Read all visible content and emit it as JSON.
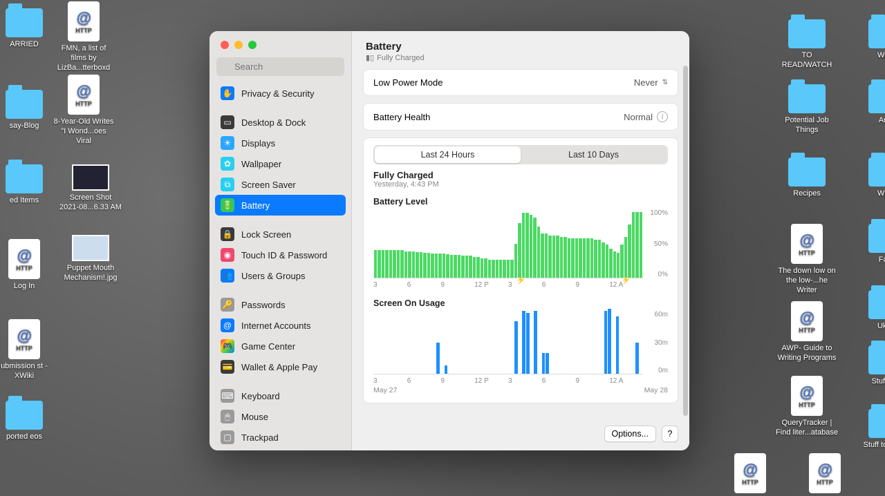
{
  "desktop_icons": {
    "left": [
      {
        "type": "fold",
        "label": "ARRIED"
      },
      {
        "type": "file",
        "label": "FMN, a list of films by LizBa...tterboxd"
      },
      {
        "type": "fold",
        "label": "say-Blog"
      },
      {
        "type": "file",
        "label": "8-Year-Old Writes \"I Wond...oes Viral"
      },
      {
        "type": "fold",
        "label": "ed Items"
      },
      {
        "type": "thumb",
        "label": "Screen Shot 2021-08...6.33 AM"
      },
      {
        "type": "file",
        "label": "Log In"
      },
      {
        "type": "thumb",
        "label": "Puppet Mouth Mechanism!.jpg"
      },
      {
        "type": "file",
        "label": "ubmission st - XWiki"
      },
      {
        "type": "fold",
        "label": "ported eos"
      }
    ],
    "right": [
      {
        "type": "fold",
        "label": "TO READ/WATCH"
      },
      {
        "type": "fold",
        "label": "Webc"
      },
      {
        "type": "fold",
        "label": "Potential Job Things"
      },
      {
        "type": "fold",
        "label": "Art S"
      },
      {
        "type": "fold",
        "label": "Recipes"
      },
      {
        "type": "fold",
        "label": "Writin"
      },
      {
        "type": "file",
        "label": "The down low on the low-...he Writer"
      },
      {
        "type": "fold",
        "label": "Fanfi"
      },
      {
        "type": "file",
        "label": "AWP- Guide to Writing Programs"
      },
      {
        "type": "fold",
        "label": "Ukule"
      },
      {
        "type": "file",
        "label": "QueryTracker | Find liter...atabase"
      },
      {
        "type": "fold",
        "label": "Stuff to S"
      },
      {
        "type": "fold",
        "label": "Stuff to Buy M"
      }
    ]
  },
  "header": {
    "title": "Battery",
    "status": "Fully Charged"
  },
  "search": {
    "placeholder": "Search"
  },
  "sidebar": [
    {
      "icon": "hand",
      "color": "#0a7aff",
      "label": "Privacy & Security"
    },
    {
      "spacer": true
    },
    {
      "icon": "dock",
      "color": "#3a3a3a",
      "label": "Desktop & Dock"
    },
    {
      "icon": "sun",
      "color": "#2aa7ff",
      "label": "Displays"
    },
    {
      "icon": "flower",
      "color": "#29cff0",
      "label": "Wallpaper"
    },
    {
      "icon": "screen",
      "color": "#29cff0",
      "label": "Screen Saver"
    },
    {
      "icon": "batt",
      "color": "#34c759",
      "label": "Battery",
      "selected": true
    },
    {
      "spacer": true
    },
    {
      "icon": "lock",
      "color": "#3a3a3a",
      "label": "Lock Screen"
    },
    {
      "icon": "finger",
      "color": "#ef476f",
      "label": "Touch ID & Password"
    },
    {
      "icon": "users",
      "color": "#0a7aff",
      "label": "Users & Groups"
    },
    {
      "spacer": true
    },
    {
      "icon": "key",
      "color": "#9a9a9a",
      "label": "Passwords"
    },
    {
      "icon": "at",
      "color": "#0a7aff",
      "label": "Internet Accounts"
    },
    {
      "icon": "gc",
      "color": "linear",
      "label": "Game Center"
    },
    {
      "icon": "wallet",
      "color": "#3a3a3a",
      "label": "Wallet & Apple Pay"
    },
    {
      "spacer": true
    },
    {
      "icon": "kb",
      "color": "#9a9a9a",
      "label": "Keyboard"
    },
    {
      "icon": "mouse",
      "color": "#9a9a9a",
      "label": "Mouse"
    },
    {
      "icon": "track",
      "color": "#9a9a9a",
      "label": "Trackpad"
    },
    {
      "icon": "print",
      "color": "#9a9a9a",
      "label": "Printers & Scanners"
    }
  ],
  "low_power": {
    "label": "Low Power Mode",
    "value": "Never"
  },
  "health": {
    "label": "Battery Health",
    "value": "Normal"
  },
  "tabs": {
    "a": "Last 24 Hours",
    "b": "Last 10 Days",
    "active": "a"
  },
  "fully_charged": {
    "title": "Fully Charged",
    "sub": "Yesterday, 4:43 PM"
  },
  "battery_level": {
    "title": "Battery Level",
    "ylabels": [
      "100%",
      "50%",
      "0%"
    ],
    "xlabels": [
      "3",
      "6",
      "9",
      "12 P",
      "3",
      "6",
      "9",
      "12 A"
    ]
  },
  "screen_on": {
    "title": "Screen On Usage",
    "ylabels": [
      "60m",
      "30m",
      "0m"
    ],
    "xlabels": [
      "3",
      "6",
      "9",
      "12 P",
      "3",
      "6",
      "9",
      "12 A"
    ],
    "date_start": "May 27",
    "date_end": "May 28"
  },
  "buttons": {
    "options": "Options...",
    "help": "?"
  },
  "chart_data": [
    {
      "type": "bar",
      "title": "Battery Level",
      "ylabel": "%",
      "ylim": [
        0,
        100
      ],
      "x_ticks": [
        "3",
        "6",
        "9",
        "12 P",
        "3",
        "6",
        "9",
        "12 A"
      ],
      "values": [
        40,
        40,
        40,
        40,
        40,
        40,
        40,
        40,
        38,
        38,
        38,
        37,
        37,
        36,
        36,
        35,
        35,
        35,
        35,
        34,
        33,
        33,
        33,
        32,
        32,
        32,
        30,
        30,
        28,
        28,
        26,
        26,
        26,
        26,
        26,
        26,
        26,
        50,
        80,
        95,
        95,
        92,
        88,
        75,
        65,
        65,
        62,
        62,
        62,
        60,
        60,
        58,
        58,
        58,
        58,
        58,
        58,
        58,
        56,
        56,
        52,
        48,
        42,
        38,
        36,
        48,
        60,
        78,
        96,
        96,
        96
      ]
    },
    {
      "type": "bar",
      "title": "Screen On Usage",
      "ylabel": "minutes",
      "ylim": [
        0,
        60
      ],
      "x_ticks": [
        "3",
        "6",
        "9",
        "12 P",
        "3",
        "6",
        "9",
        "12 A"
      ],
      "values": [
        0,
        0,
        0,
        0,
        0,
        0,
        0,
        0,
        0,
        0,
        0,
        0,
        0,
        0,
        0,
        0,
        30,
        0,
        8,
        0,
        0,
        0,
        0,
        0,
        0,
        0,
        0,
        0,
        0,
        0,
        0,
        0,
        0,
        0,
        0,
        0,
        50,
        0,
        60,
        58,
        0,
        60,
        0,
        20,
        20,
        0,
        0,
        0,
        0,
        0,
        0,
        0,
        0,
        0,
        0,
        0,
        0,
        0,
        0,
        60,
        62,
        0,
        55,
        0,
        0,
        0,
        0,
        30,
        0
      ]
    }
  ]
}
